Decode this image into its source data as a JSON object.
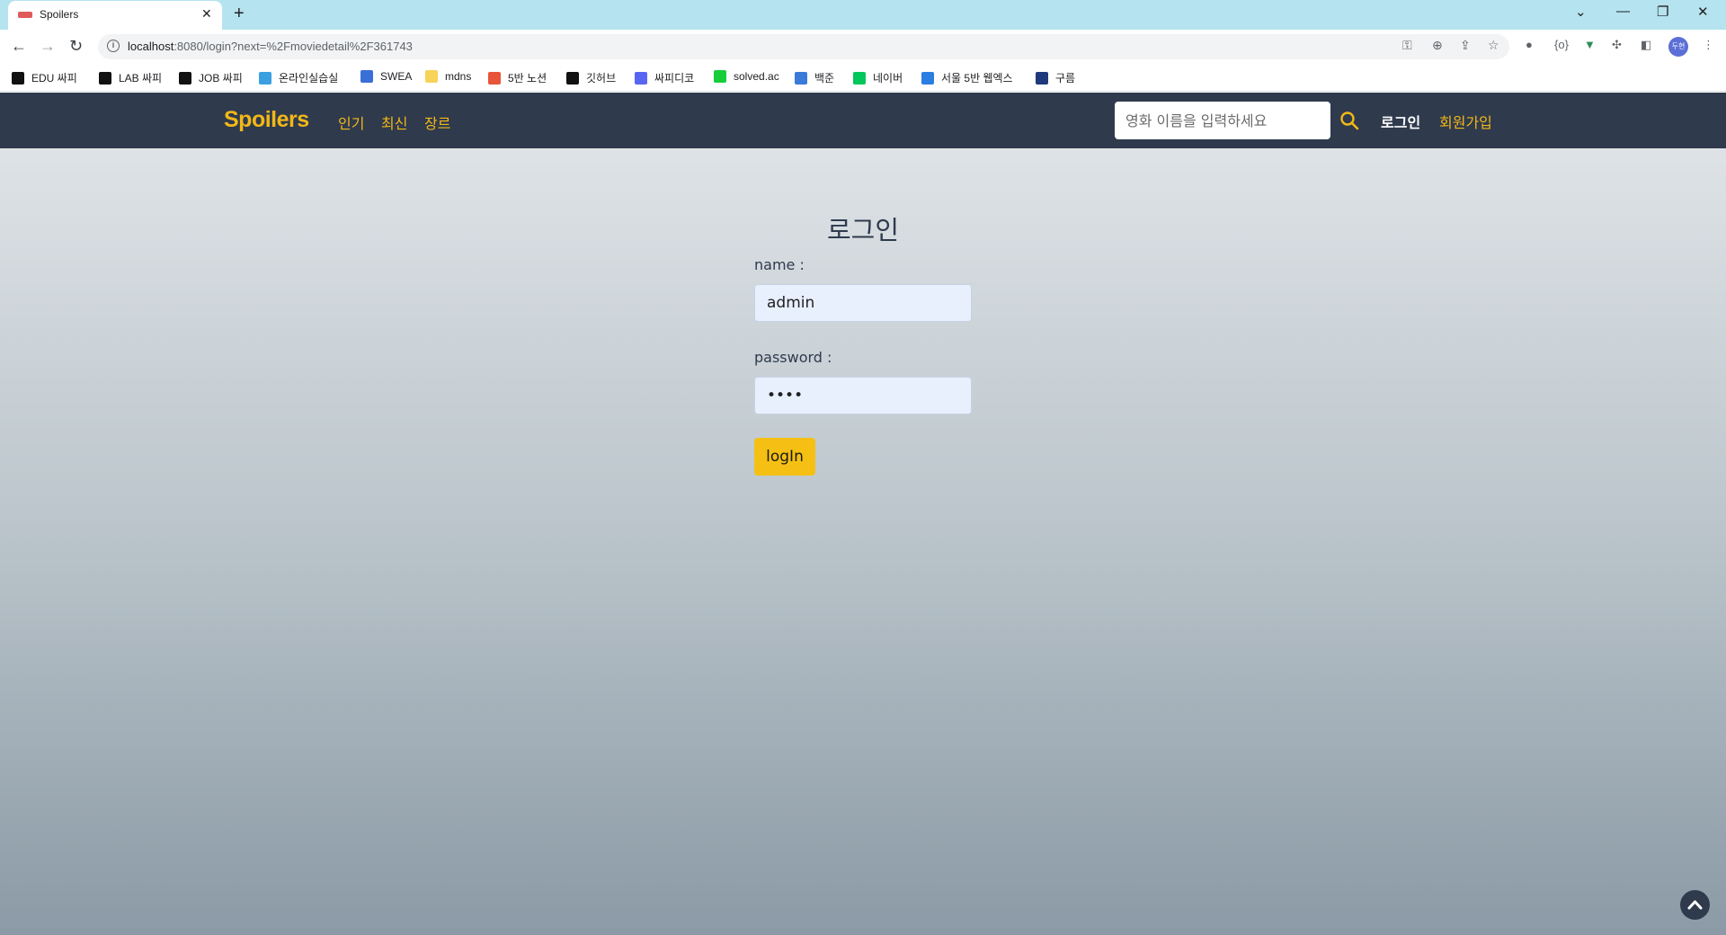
{
  "browser": {
    "tab_title": "Spoilers",
    "tab_close": "✕",
    "new_tab": "+",
    "url_host": "localhost",
    "url_rest": ":8080/login?next=%2Fmoviedetail%2F361743",
    "profile_text": "두현",
    "bookmarks": [
      {
        "label": "EDU 싸피",
        "color": "#111111"
      },
      {
        "label": "LAB 싸피",
        "color": "#111111"
      },
      {
        "label": "JOB 싸피",
        "color": "#111111"
      },
      {
        "label": "온라인실습실",
        "color": "#3aa0e0"
      },
      {
        "label": "SWEA",
        "color": "#3a6fd8"
      },
      {
        "label": "mdns",
        "color": "#f7d35a"
      },
      {
        "label": "5반 노션",
        "color": "#e8553a"
      },
      {
        "label": "깃허브",
        "color": "#111111"
      },
      {
        "label": "싸피디코",
        "color": "#5865f2"
      },
      {
        "label": "solved.ac",
        "color": "#17ce3a"
      },
      {
        "label": "백준",
        "color": "#3a7ad8"
      },
      {
        "label": "네이버",
        "color": "#03c75a"
      },
      {
        "label": "서울 5반 웹엑스",
        "color": "#2a7de1"
      },
      {
        "label": "구름",
        "color": "#1f3a7a"
      }
    ]
  },
  "navbar": {
    "brand": "Spoilers",
    "links": [
      "인기",
      "최신",
      "장르"
    ],
    "search_placeholder": "영화 이름을 입력하세요",
    "login": "로그인",
    "signup": "회원가입"
  },
  "login": {
    "title": "로그인",
    "name_label": "name :",
    "name_value": "admin",
    "password_label": "password :",
    "password_value": "pass",
    "button": "logIn"
  },
  "colors": {
    "brand": "#f2b817",
    "navbar_bg": "#2f3a4d",
    "button_bg": "#f5c013"
  }
}
